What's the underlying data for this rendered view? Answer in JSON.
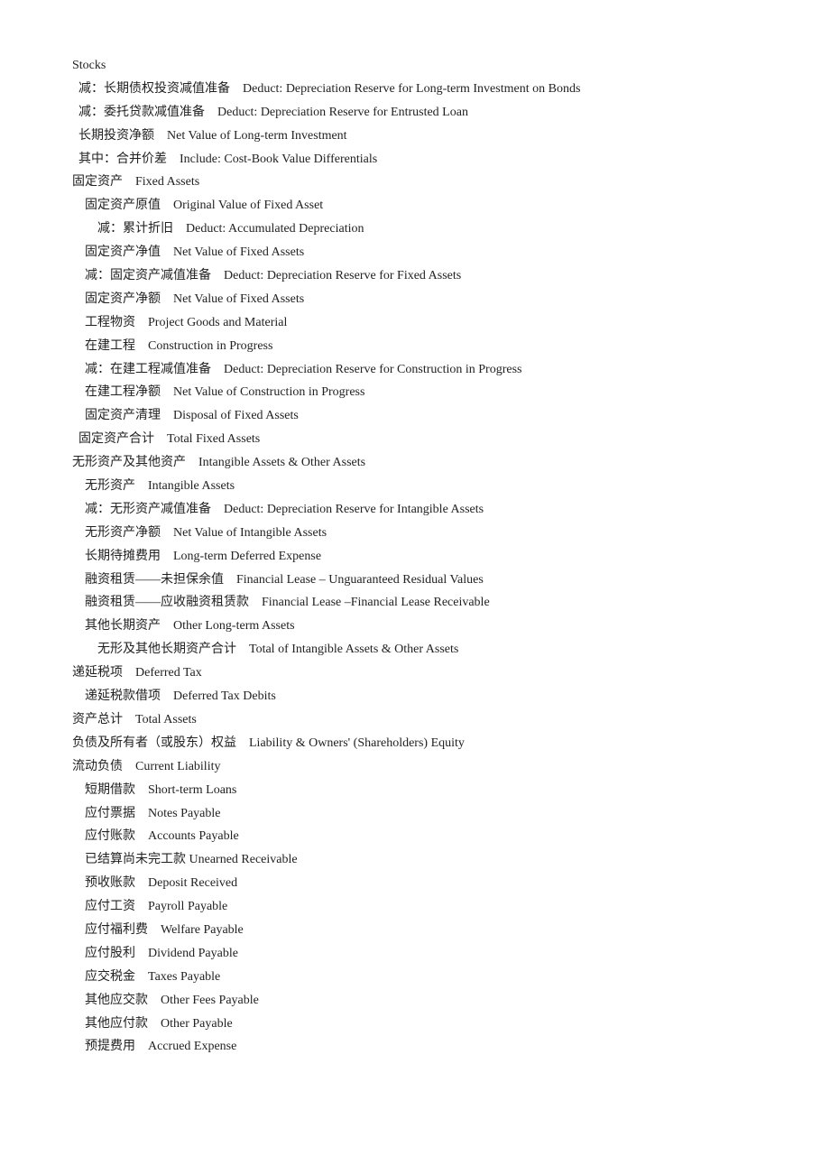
{
  "lines": [
    {
      "text": "Stocks",
      "indent": 0
    },
    {
      "text": "  减：长期债权投资减值准备    Deduct: Depreciation Reserve for Long-term Investment on Bonds",
      "indent": 1
    },
    {
      "text": "  减：委托贷款减值准备    Deduct: Depreciation Reserve for Entrusted Loan",
      "indent": 1
    },
    {
      "text": "  长期投资净额    Net Value of Long-term Investment",
      "indent": 1
    },
    {
      "text": "  其中：合并价差    Include: Cost-Book Value Differentials",
      "indent": 1
    },
    {
      "text": "固定资产    Fixed Assets",
      "indent": 0
    },
    {
      "text": "    固定资产原值    Original Value of Fixed Asset",
      "indent": 1
    },
    {
      "text": "        减：累计折旧    Deduct: Accumulated Depreciation",
      "indent": 2
    },
    {
      "text": "    固定资产净值    Net Value of Fixed Assets",
      "indent": 1
    },
    {
      "text": "    减：固定资产减值准备    Deduct: Depreciation Reserve for Fixed Assets",
      "indent": 1
    },
    {
      "text": "    固定资产净额    Net Value of Fixed Assets",
      "indent": 1
    },
    {
      "text": "    工程物资    Project Goods and Material",
      "indent": 1
    },
    {
      "text": "    在建工程    Construction in Progress",
      "indent": 1
    },
    {
      "text": "    减：在建工程减值准备    Deduct: Depreciation Reserve for Construction in Progress",
      "indent": 1
    },
    {
      "text": "    在建工程净额    Net Value of Construction in Progress",
      "indent": 1
    },
    {
      "text": "    固定资产清理    Disposal of Fixed Assets",
      "indent": 1
    },
    {
      "text": "  固定资产合计    Total Fixed Assets",
      "indent": 0
    },
    {
      "text": "无形资产及其他资产    Intangible Assets & Other Assets",
      "indent": 0
    },
    {
      "text": "    无形资产    Intangible Assets",
      "indent": 1
    },
    {
      "text": "    减：无形资产减值准备    Deduct: Depreciation Reserve for Intangible Assets",
      "indent": 1
    },
    {
      "text": "    无形资产净额    Net Value of Intangible Assets",
      "indent": 1
    },
    {
      "text": "    长期待摊费用    Long-term Deferred Expense",
      "indent": 1
    },
    {
      "text": "    融资租赁——未担保余值    Financial Lease – Unguaranteed Residual Values",
      "indent": 1
    },
    {
      "text": "    融资租赁——应收融资租赁款    Financial Lease –Financial Lease Receivable",
      "indent": 1
    },
    {
      "text": "    其他长期资产    Other Long-term Assets",
      "indent": 1
    },
    {
      "text": "        无形及其他长期资产合计    Total of Intangible Assets & Other Assets",
      "indent": 2
    },
    {
      "text": "递延税项    Deferred Tax",
      "indent": 0
    },
    {
      "text": "    递延税款借项    Deferred Tax Debits",
      "indent": 1
    },
    {
      "text": "资产总计    Total Assets",
      "indent": 0
    },
    {
      "text": "负债及所有者（或股东）权益    Liability & Owners' (Shareholders) Equity",
      "indent": 0
    },
    {
      "text": "流动负债    Current Liability",
      "indent": 0
    },
    {
      "text": "    短期借款    Short-term Loans",
      "indent": 1
    },
    {
      "text": "    应付票据    Notes Payable",
      "indent": 1
    },
    {
      "text": "    应付账款    Accounts Payable",
      "indent": 1
    },
    {
      "text": "    已结算尚未完工款 Unearned Receivable",
      "indent": 1
    },
    {
      "text": "    预收账款    Deposit Received",
      "indent": 1
    },
    {
      "text": "    应付工资    Payroll Payable",
      "indent": 1
    },
    {
      "text": "    应付福利费    Welfare Payable",
      "indent": 1
    },
    {
      "text": "    应付股利    Dividend Payable",
      "indent": 1
    },
    {
      "text": "    应交税金    Taxes Payable",
      "indent": 1
    },
    {
      "text": "    其他应交款    Other Fees Payable",
      "indent": 1
    },
    {
      "text": "    其他应付款    Other Payable",
      "indent": 1
    },
    {
      "text": "    预提费用    Accrued Expense",
      "indent": 1
    }
  ]
}
